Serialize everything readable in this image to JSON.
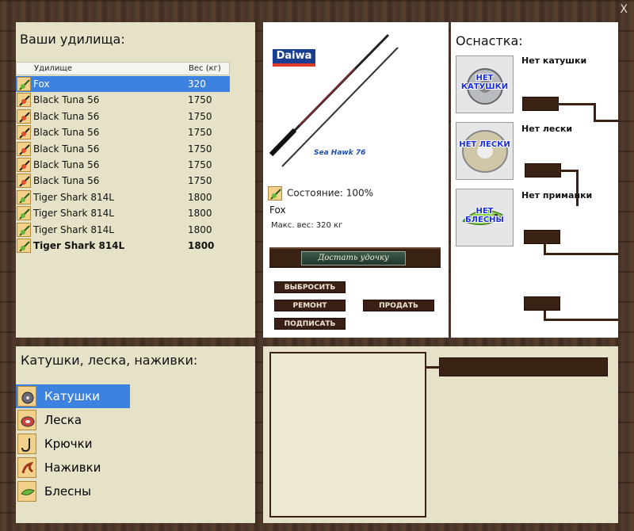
{
  "window": {
    "close_label": "X"
  },
  "rods": {
    "title": "Ваши удилища:",
    "columns": {
      "name": "Удилище",
      "weight": "Вес (кг)"
    },
    "items": [
      {
        "name": "Fox",
        "weight": "320",
        "selected": true,
        "bold": false
      },
      {
        "name": "Black Tuna 56",
        "weight": "1750",
        "selected": false,
        "bold": false
      },
      {
        "name": "Black Tuna 56",
        "weight": "1750",
        "selected": false,
        "bold": false
      },
      {
        "name": "Black Tuna 56",
        "weight": "1750",
        "selected": false,
        "bold": false
      },
      {
        "name": "Black Tuna 56",
        "weight": "1750",
        "selected": false,
        "bold": false
      },
      {
        "name": "Black Tuna 56",
        "weight": "1750",
        "selected": false,
        "bold": false
      },
      {
        "name": "Black Tuna 56",
        "weight": "1750",
        "selected": false,
        "bold": false
      },
      {
        "name": "Tiger Shark 814L",
        "weight": "1800",
        "selected": false,
        "bold": false
      },
      {
        "name": "Tiger Shark 814L",
        "weight": "1800",
        "selected": false,
        "bold": false
      },
      {
        "name": "Tiger Shark 814L",
        "weight": "1800",
        "selected": false,
        "bold": false
      },
      {
        "name": "Tiger Shark 814L",
        "weight": "1800",
        "selected": false,
        "bold": true
      }
    ]
  },
  "rod_detail": {
    "brand": "Daiwa",
    "model_label": "Sea Hawk 76",
    "state": "Состояние: 100%",
    "name": "Fox",
    "max_weight": "Макс. вес: 320 кг",
    "get_rod_label": "Достать удочку",
    "buttons": {
      "discard": "ВЫБРОСИТЬ",
      "repair": "РЕМОНТ",
      "sell": "ПРОДАТЬ",
      "sign": "ПОДПИСАТЬ"
    }
  },
  "tackle": {
    "title": "Оснастка:",
    "reel": {
      "image_label": "НЕТ КАТУШКИ",
      "text": "Нет катушки"
    },
    "line": {
      "image_label": "НЕТ ЛЕСКИ",
      "text": "Нет лески"
    },
    "lure": {
      "image_label": "НЕТ БЛЕСНЫ",
      "text": "Нет приманки"
    }
  },
  "items": {
    "title": "Катушки, леска, наживки:",
    "categories": [
      {
        "label": "Катушки",
        "icon": "reel-icon",
        "selected": true
      },
      {
        "label": "Леска",
        "icon": "line-spool-icon",
        "selected": false
      },
      {
        "label": "Крючки",
        "icon": "hook-icon",
        "selected": false
      },
      {
        "label": "Наживки",
        "icon": "bait-icon",
        "selected": false
      },
      {
        "label": "Блесны",
        "icon": "lure-icon",
        "selected": false
      }
    ]
  },
  "colors": {
    "panel": "#e6e2c8",
    "selected": "#3d82e0",
    "wood_dark": "#3a2214"
  }
}
